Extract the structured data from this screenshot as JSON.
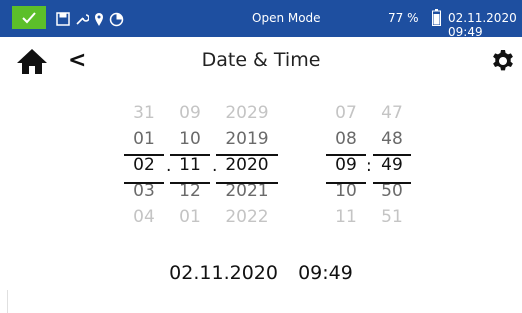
{
  "status": {
    "ok_color": "#5cbf2a",
    "bar_color": "#1e4fa0",
    "icons": [
      "check-icon",
      "save-icon",
      "wrench-icon",
      "location-pin-icon",
      "timer-icon"
    ],
    "mode": "Open Mode",
    "battery": "77 %",
    "clock": "02.11.2020 09:49"
  },
  "header": {
    "title": "Date & Time",
    "home_icon": "home-icon",
    "back_icon": "back-chevron-icon",
    "settings_icon": "gear-icon",
    "back_glyph": "<"
  },
  "picker": {
    "day": [
      "31",
      "01",
      "02",
      "03",
      "04"
    ],
    "month": [
      "09",
      "10",
      "11",
      "12",
      "01"
    ],
    "year": [
      "2029",
      "2019",
      "2020",
      "2021",
      "2022"
    ],
    "hour": [
      "07",
      "08",
      "09",
      "10",
      "11"
    ],
    "minute": [
      "47",
      "48",
      "49",
      "50",
      "51"
    ],
    "date_sep": ".",
    "time_sep": ":"
  },
  "summary": {
    "date": "02.11.2020",
    "time": "09:49"
  }
}
